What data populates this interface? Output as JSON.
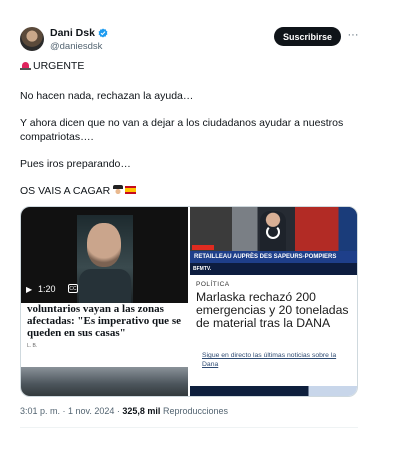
{
  "author": {
    "name": "Dani Dsk",
    "handle": "@daniesdsk",
    "verified_icon": "verified-badge-icon"
  },
  "actions": {
    "subscribe_label": "Suscribirse",
    "more_label": "···"
  },
  "text": {
    "line1": "URGENTE",
    "line2": "No hacen nada, rechazan la ayuda…",
    "line3a": "Y ahora dicen que no van a dejar a los ciudadanos ayudar a nuestros",
    "line3b": "compatriotas….",
    "line4": "Pues iros preparando…",
    "line5": "OS VAIS A CAGAR"
  },
  "media": {
    "video": {
      "play_icon": "play-icon",
      "duration": "1:20",
      "cc_label": "CC"
    },
    "article1": {
      "headline": "voluntarios vayan a las zonas afectadas: \"Es imperativo que se queden en sus casas\"",
      "source": "L. B."
    },
    "tv": {
      "banner": "RETAILLEAU AUPRÈS DES SAPEURS-POMPIERS",
      "channel": "BFMTV."
    },
    "article2": {
      "category": "POLÍTICA",
      "headline": "Marlaska rechazó 200 emergencias y 20 toneladas de material tras la DANA",
      "link": "Sigue en directo las últimas noticias sobre la Dana"
    }
  },
  "meta": {
    "time": "3:01 p. m.",
    "sep": " · ",
    "date": "1 nov. 2024",
    "views": "325,8 mil",
    "views_label": "Reproducciones"
  },
  "colors": {
    "accent": "#1d9bf0",
    "text": "#0f1419",
    "secondary": "#536471",
    "button_bg": "#0f1419"
  }
}
